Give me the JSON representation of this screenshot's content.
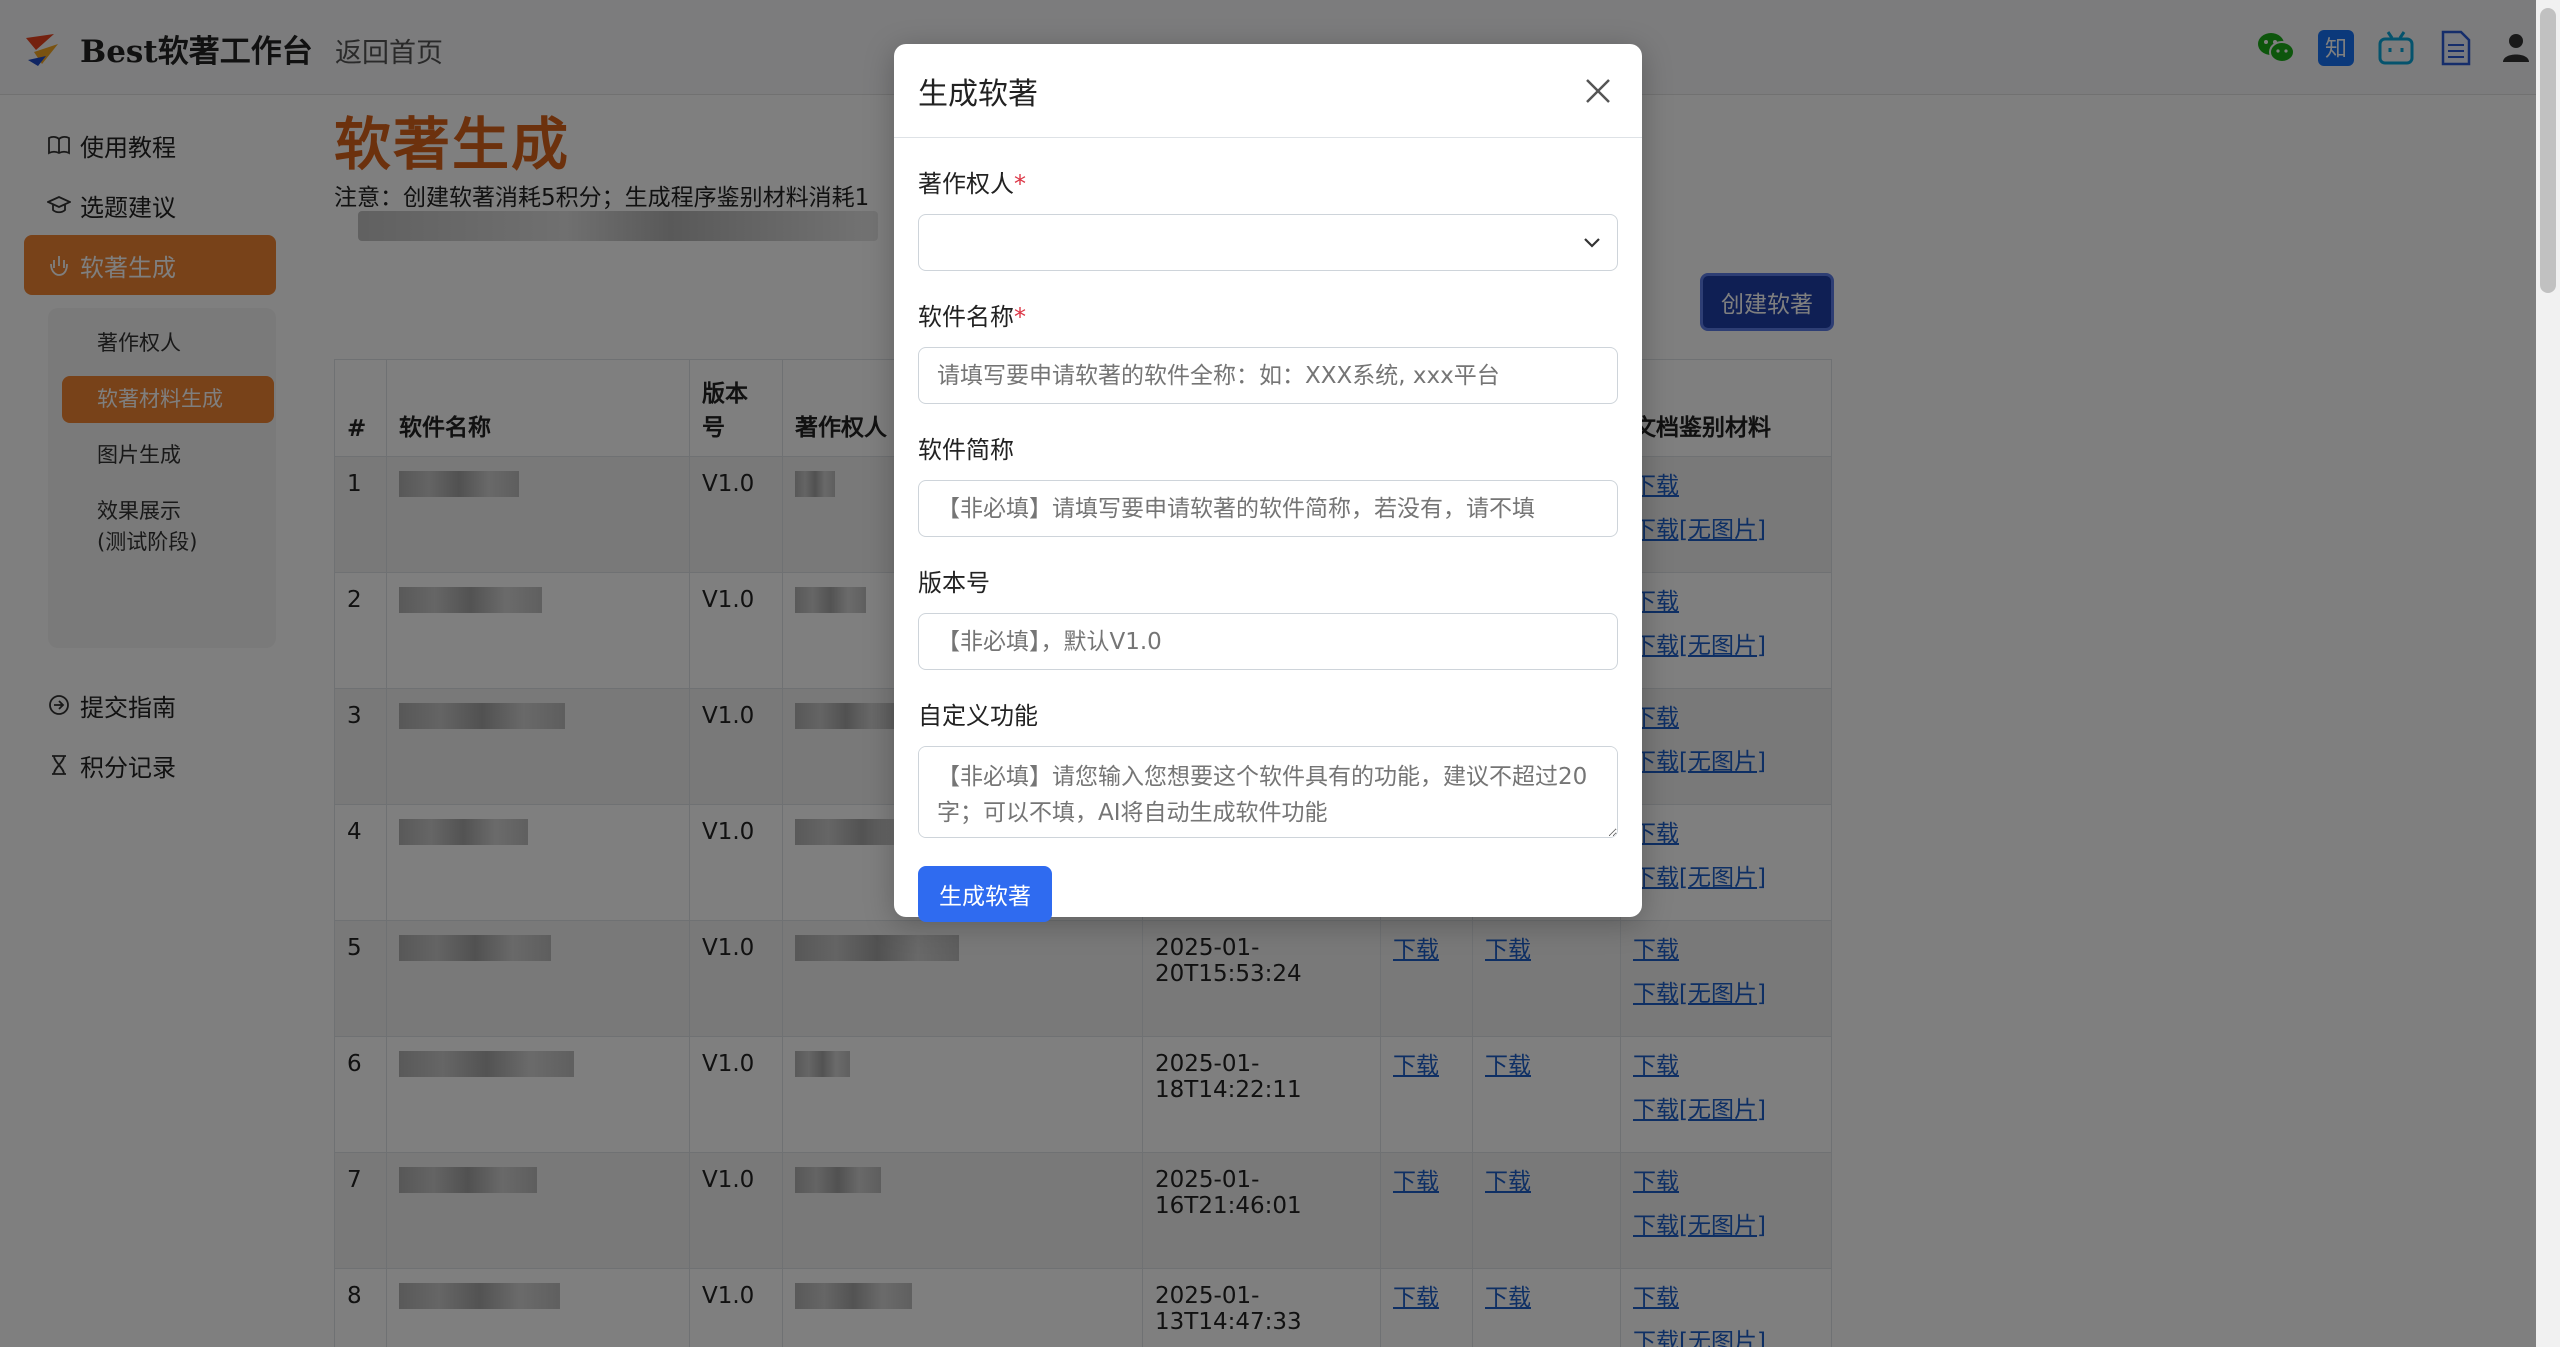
{
  "brand": {
    "title": "Best软著工作台",
    "back_home": "返回首页"
  },
  "top_icons": [
    "wechat-icon",
    "zhihu-icon",
    "bilibili-icon",
    "document-icon",
    "user-icon"
  ],
  "sidebar": {
    "items": [
      {
        "label": "使用教程",
        "icon": "book-icon"
      },
      {
        "label": "选题建议",
        "icon": "graduation-cap-icon"
      },
      {
        "label": "软著生成",
        "icon": "hand-icon"
      },
      {
        "label": "提交指南",
        "icon": "arrow-circle-icon"
      },
      {
        "label": "积分记录",
        "icon": "hourglass-icon"
      }
    ],
    "sub_items": [
      {
        "label": "著作权人"
      },
      {
        "label": "软著材料生成"
      },
      {
        "label": "图片生成"
      },
      {
        "label": "效果展示\n(测试阶段)"
      }
    ]
  },
  "main": {
    "title": "软著生成",
    "notice": "注意：创建软著消耗5积分；生成程序鉴别材料消耗1",
    "create_button": "创建软著",
    "table": {
      "headers": [
        "#",
        "软件名称",
        "版本号",
        "著作权人",
        "",
        "",
        "",
        "文档鉴别材料"
      ],
      "rows": [
        {
          "num": "1",
          "version": "V1.0",
          "date": "",
          "col5": "",
          "col6": ""
        },
        {
          "num": "2",
          "version": "V1.0",
          "date": "",
          "col5": "",
          "col6": ""
        },
        {
          "num": "3",
          "version": "V1.0",
          "date": "",
          "col5": "",
          "col6": ""
        },
        {
          "num": "4",
          "version": "V1.0",
          "date": "",
          "col5": "",
          "col6": ""
        },
        {
          "num": "5",
          "version": "V1.0",
          "date": "2025-01-20T15:53:24",
          "col5": "下载",
          "col6": "下载"
        },
        {
          "num": "6",
          "version": "V1.0",
          "date": "2025-01-18T14:22:11",
          "col5": "下载",
          "col6": "下载"
        },
        {
          "num": "7",
          "version": "V1.0",
          "date": "2025-01-16T21:46:01",
          "col5": "下载",
          "col6": "下载"
        },
        {
          "num": "8",
          "version": "V1.0",
          "date": "2025-01-13T14:47:33",
          "col5": "下载",
          "col6": "下载"
        }
      ],
      "link_download": "下载",
      "link_download_noimg": "下载[无图片]"
    }
  },
  "modal": {
    "title": "生成软著",
    "fields": {
      "owner": {
        "label": "著作权人",
        "required_mark": "*"
      },
      "name": {
        "label": "软件名称",
        "required_mark": "*",
        "placeholder": "请填写要申请软著的软件全称：如：XXX系统, xxx平台"
      },
      "short_name": {
        "label": "软件简称",
        "placeholder": "【非必填】请填写要申请软著的软件简称，若没有，请不填"
      },
      "version": {
        "label": "版本号",
        "placeholder": "【非必填】，默认V1.0"
      },
      "custom_function": {
        "label": "自定义功能",
        "placeholder": "【非必填】请您输入您想要这个软件具有的功能，建议不超过20字；可以不填，AI将自动生成软件功能"
      }
    },
    "submit": "生成软著"
  }
}
